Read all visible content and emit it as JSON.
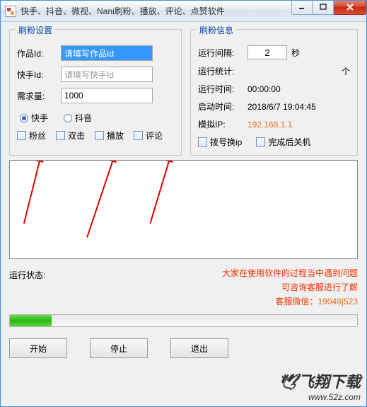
{
  "title": "快手、抖音、微视、Nani刷粉、播放、评论、点赞软件",
  "settings": {
    "group_title": "刷粉设置",
    "work_id_label": "作品Id:",
    "work_id_placeholder": "请填写作品Id",
    "ks_id_label": "快手Id:",
    "ks_id_placeholder": "请填写快手Id",
    "demand_label": "需求量:",
    "demand_value": "1000",
    "radio_kuaishou": "快手",
    "radio_douyin": "抖音",
    "cb_fans": "粉丝",
    "cb_double": "双击",
    "cb_play": "播放",
    "cb_comment": "评论"
  },
  "info": {
    "group_title": "刷粉信息",
    "interval_label": "运行间隔:",
    "interval_value": "2",
    "interval_unit": "秒",
    "stats_label": "运行统计:",
    "stats_unit": "个",
    "runtime_label": "运行时间:",
    "runtime_value": "00:00:00",
    "start_label": "启动时间:",
    "start_value": "2018/6/7 19:04:45",
    "ip_label": "模拟IP:",
    "ip_value": "192.168.1.1",
    "cb_dial": "拨号换ip",
    "cb_shutdown": "完成后关机"
  },
  "status": {
    "label": "运行状态:",
    "line1": "大家在使用软件的过程当中遇到问题",
    "line2": "可咨询客服进行了解",
    "line3_prefix": "客服微信：",
    "line3_num": "19048|523"
  },
  "buttons": {
    "start": "开始",
    "stop": "停止",
    "exit": "退出"
  },
  "watermark": {
    "brand": "飞翔下载",
    "url": "www.52z.com"
  }
}
